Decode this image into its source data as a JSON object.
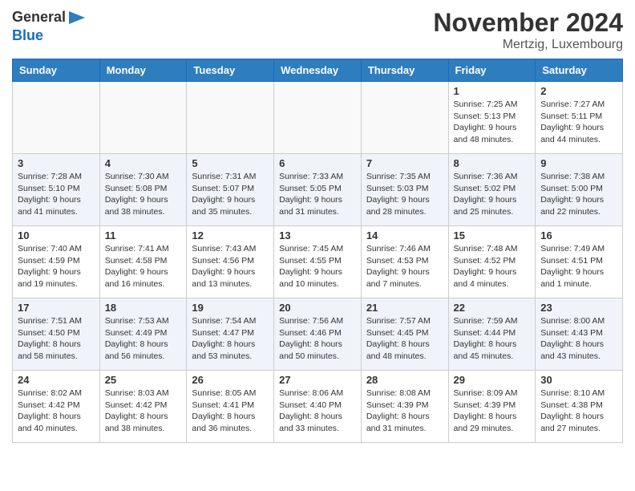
{
  "header": {
    "logo_line1": "General",
    "logo_line2": "Blue",
    "month_title": "November 2024",
    "location": "Mertzig, Luxembourg"
  },
  "weekdays": [
    "Sunday",
    "Monday",
    "Tuesday",
    "Wednesday",
    "Thursday",
    "Friday",
    "Saturday"
  ],
  "weeks": [
    [
      {
        "day": "",
        "info": ""
      },
      {
        "day": "",
        "info": ""
      },
      {
        "day": "",
        "info": ""
      },
      {
        "day": "",
        "info": ""
      },
      {
        "day": "",
        "info": ""
      },
      {
        "day": "1",
        "info": "Sunrise: 7:25 AM\nSunset: 5:13 PM\nDaylight: 9 hours and 48 minutes."
      },
      {
        "day": "2",
        "info": "Sunrise: 7:27 AM\nSunset: 5:11 PM\nDaylight: 9 hours and 44 minutes."
      }
    ],
    [
      {
        "day": "3",
        "info": "Sunrise: 7:28 AM\nSunset: 5:10 PM\nDaylight: 9 hours and 41 minutes."
      },
      {
        "day": "4",
        "info": "Sunrise: 7:30 AM\nSunset: 5:08 PM\nDaylight: 9 hours and 38 minutes."
      },
      {
        "day": "5",
        "info": "Sunrise: 7:31 AM\nSunset: 5:07 PM\nDaylight: 9 hours and 35 minutes."
      },
      {
        "day": "6",
        "info": "Sunrise: 7:33 AM\nSunset: 5:05 PM\nDaylight: 9 hours and 31 minutes."
      },
      {
        "day": "7",
        "info": "Sunrise: 7:35 AM\nSunset: 5:03 PM\nDaylight: 9 hours and 28 minutes."
      },
      {
        "day": "8",
        "info": "Sunrise: 7:36 AM\nSunset: 5:02 PM\nDaylight: 9 hours and 25 minutes."
      },
      {
        "day": "9",
        "info": "Sunrise: 7:38 AM\nSunset: 5:00 PM\nDaylight: 9 hours and 22 minutes."
      }
    ],
    [
      {
        "day": "10",
        "info": "Sunrise: 7:40 AM\nSunset: 4:59 PM\nDaylight: 9 hours and 19 minutes."
      },
      {
        "day": "11",
        "info": "Sunrise: 7:41 AM\nSunset: 4:58 PM\nDaylight: 9 hours and 16 minutes."
      },
      {
        "day": "12",
        "info": "Sunrise: 7:43 AM\nSunset: 4:56 PM\nDaylight: 9 hours and 13 minutes."
      },
      {
        "day": "13",
        "info": "Sunrise: 7:45 AM\nSunset: 4:55 PM\nDaylight: 9 hours and 10 minutes."
      },
      {
        "day": "14",
        "info": "Sunrise: 7:46 AM\nSunset: 4:53 PM\nDaylight: 9 hours and 7 minutes."
      },
      {
        "day": "15",
        "info": "Sunrise: 7:48 AM\nSunset: 4:52 PM\nDaylight: 9 hours and 4 minutes."
      },
      {
        "day": "16",
        "info": "Sunrise: 7:49 AM\nSunset: 4:51 PM\nDaylight: 9 hours and 1 minute."
      }
    ],
    [
      {
        "day": "17",
        "info": "Sunrise: 7:51 AM\nSunset: 4:50 PM\nDaylight: 8 hours and 58 minutes."
      },
      {
        "day": "18",
        "info": "Sunrise: 7:53 AM\nSunset: 4:49 PM\nDaylight: 8 hours and 56 minutes."
      },
      {
        "day": "19",
        "info": "Sunrise: 7:54 AM\nSunset: 4:47 PM\nDaylight: 8 hours and 53 minutes."
      },
      {
        "day": "20",
        "info": "Sunrise: 7:56 AM\nSunset: 4:46 PM\nDaylight: 8 hours and 50 minutes."
      },
      {
        "day": "21",
        "info": "Sunrise: 7:57 AM\nSunset: 4:45 PM\nDaylight: 8 hours and 48 minutes."
      },
      {
        "day": "22",
        "info": "Sunrise: 7:59 AM\nSunset: 4:44 PM\nDaylight: 8 hours and 45 minutes."
      },
      {
        "day": "23",
        "info": "Sunrise: 8:00 AM\nSunset: 4:43 PM\nDaylight: 8 hours and 43 minutes."
      }
    ],
    [
      {
        "day": "24",
        "info": "Sunrise: 8:02 AM\nSunset: 4:42 PM\nDaylight: 8 hours and 40 minutes."
      },
      {
        "day": "25",
        "info": "Sunrise: 8:03 AM\nSunset: 4:42 PM\nDaylight: 8 hours and 38 minutes."
      },
      {
        "day": "26",
        "info": "Sunrise: 8:05 AM\nSunset: 4:41 PM\nDaylight: 8 hours and 36 minutes."
      },
      {
        "day": "27",
        "info": "Sunrise: 8:06 AM\nSunset: 4:40 PM\nDaylight: 8 hours and 33 minutes."
      },
      {
        "day": "28",
        "info": "Sunrise: 8:08 AM\nSunset: 4:39 PM\nDaylight: 8 hours and 31 minutes."
      },
      {
        "day": "29",
        "info": "Sunrise: 8:09 AM\nSunset: 4:39 PM\nDaylight: 8 hours and 29 minutes."
      },
      {
        "day": "30",
        "info": "Sunrise: 8:10 AM\nSunset: 4:38 PM\nDaylight: 8 hours and 27 minutes."
      }
    ]
  ]
}
